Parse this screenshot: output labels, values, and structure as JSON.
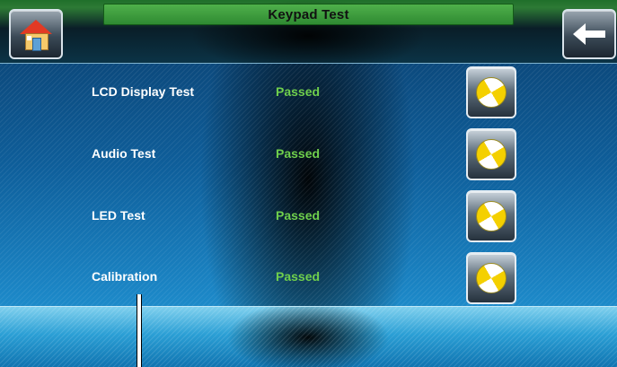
{
  "header": {
    "title": "Keypad Test"
  },
  "nav": {
    "home_icon": "home-icon",
    "back_icon": "back-arrow-icon"
  },
  "tests": [
    {
      "label": "LCD Display Test",
      "status": "Passed",
      "icon": "test-run-icon"
    },
    {
      "label": "Audio Test",
      "status": "Passed",
      "icon": "test-run-icon"
    },
    {
      "label": "LED Test",
      "status": "Passed",
      "icon": "test-run-icon"
    },
    {
      "label": "Calibration",
      "status": "Passed",
      "icon": "test-run-icon"
    }
  ],
  "colors": {
    "status_passed": "#6fcf4c",
    "title_bar": "#3f9e40",
    "accent_blue": "#1b86c6"
  }
}
